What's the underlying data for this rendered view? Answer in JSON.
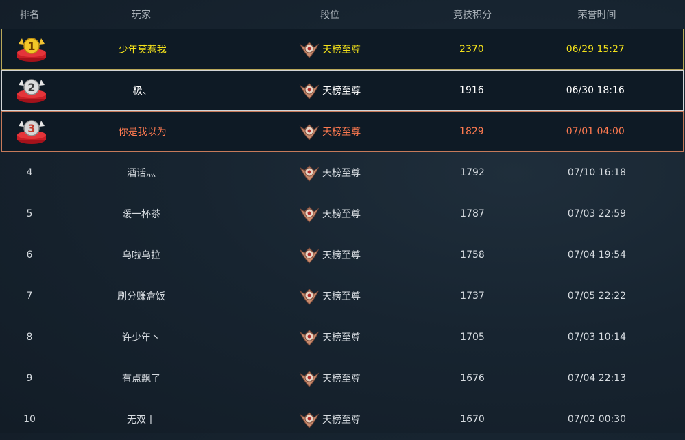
{
  "header": {
    "rank": "排名",
    "player": "玩家",
    "tier": "段位",
    "score": "竞技积分",
    "time": "荣誉时间"
  },
  "colors": {
    "gold": "#f4e21a",
    "silver": "#ffffff",
    "bronze": "#ff7a50",
    "normal": "#d6dbe0"
  },
  "rows": [
    {
      "rank": "1",
      "medal": "gold-medal-icon",
      "player": "少年莫惹我",
      "tier": "天榜至尊",
      "score": "2370",
      "time": "06/29 15:27"
    },
    {
      "rank": "2",
      "medal": "silver-medal-icon",
      "player": "极、",
      "tier": "天榜至尊",
      "score": "1916",
      "time": "06/30 18:16"
    },
    {
      "rank": "3",
      "medal": "bronze-medal-icon",
      "player": "你是我以为",
      "tier": "天榜至尊",
      "score": "1829",
      "time": "07/01 04:00"
    },
    {
      "rank": "4",
      "player": "酒话灬",
      "tier": "天榜至尊",
      "score": "1792",
      "time": "07/10 16:18"
    },
    {
      "rank": "5",
      "player": "暖一杯茶",
      "tier": "天榜至尊",
      "score": "1787",
      "time": "07/03 22:59"
    },
    {
      "rank": "6",
      "player": "乌啦乌拉",
      "tier": "天榜至尊",
      "score": "1758",
      "time": "07/04 19:54"
    },
    {
      "rank": "7",
      "player": "刷分赚盒饭",
      "tier": "天榜至尊",
      "score": "1737",
      "time": "07/05 22:22"
    },
    {
      "rank": "8",
      "player": "许少年丶",
      "tier": "天榜至尊",
      "score": "1705",
      "time": "07/03 10:14"
    },
    {
      "rank": "9",
      "player": "有点飘了",
      "tier": "天榜至尊",
      "score": "1676",
      "time": "07/04 22:13"
    },
    {
      "rank": "10",
      "player": "无双丨",
      "tier": "天榜至尊",
      "score": "1670",
      "time": "07/02 00:30"
    }
  ]
}
